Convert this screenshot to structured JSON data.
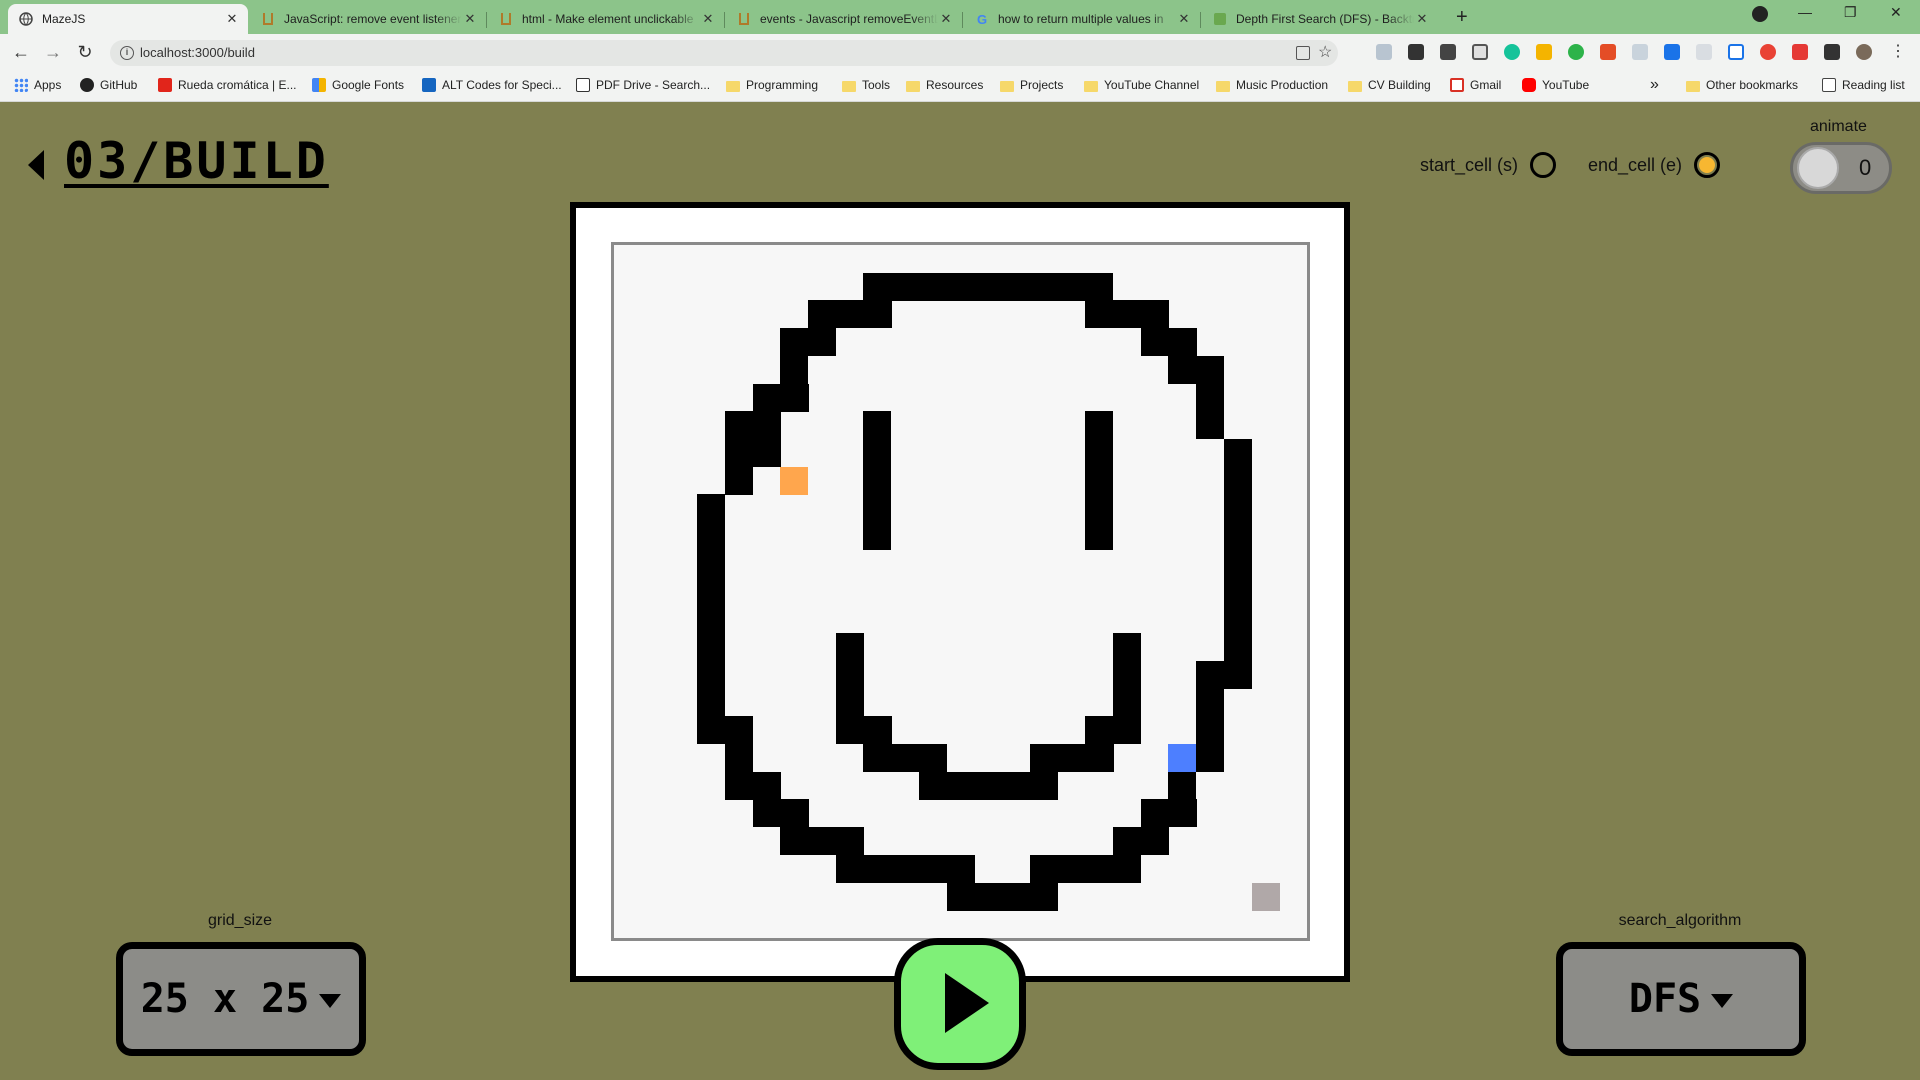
{
  "browser": {
    "tabs": [
      {
        "title": "MazeJS",
        "active": true
      },
      {
        "title": "JavaScript: remove event listener",
        "active": false
      },
      {
        "title": "html - Make element unclickable",
        "active": false
      },
      {
        "title": "events - Javascript removeEventL",
        "active": false
      },
      {
        "title": "how to return multiple values in",
        "active": false
      },
      {
        "title": "Depth First Search (DFS) - Backtr",
        "active": false
      }
    ],
    "url": "localhost:3000/build",
    "bookmarks": [
      {
        "label": "Apps",
        "icon": "apps-grid-icon"
      },
      {
        "label": "GitHub",
        "icon": "github-icon"
      },
      {
        "label": "Rueda cromática | E...",
        "icon": "adobe-icon"
      },
      {
        "label": "Google Fonts",
        "icon": "google-fonts-icon"
      },
      {
        "label": "ALT Codes for Speci...",
        "icon": "altcodes-icon"
      },
      {
        "label": "PDF Drive - Search...",
        "icon": "pdfdrive-icon"
      },
      {
        "label": "Programming",
        "icon": "folder-icon"
      },
      {
        "label": "Tools",
        "icon": "folder-icon"
      },
      {
        "label": "Resources",
        "icon": "folder-icon"
      },
      {
        "label": "Projects",
        "icon": "folder-icon"
      },
      {
        "label": "YouTube Channel",
        "icon": "folder-icon"
      },
      {
        "label": "Music Production",
        "icon": "folder-icon"
      },
      {
        "label": "CV Building",
        "icon": "folder-icon"
      },
      {
        "label": "Gmail",
        "icon": "gmail-icon"
      },
      {
        "label": "YouTube",
        "icon": "youtube-icon"
      }
    ],
    "overflow": "»",
    "other_bookmarks": "Other bookmarks",
    "reading_list": "Reading list"
  },
  "app": {
    "title": "03/BUILD",
    "start_cell_label": "start_cell (s)",
    "end_cell_label": "end_cell (e)",
    "animate_label": "animate",
    "animate_value": "0",
    "grid_size_label": "grid_size",
    "grid_size_value": "25 x 25",
    "search_algorithm_label": "search_algorithm",
    "search_algorithm_value": "DFS",
    "colors": {
      "background": "#808050",
      "wall": "#000000",
      "empty": "#f7f7f7",
      "start": "#ffa64d",
      "end": "#4d7fff",
      "marker": "#b0a8a8",
      "play": "#7ff078",
      "end_radio_dot": "#f7b731"
    },
    "grid": {
      "size": 25,
      "walls": [
        "...........................",
        "....................................",
        "....."
      ]
    }
  }
}
